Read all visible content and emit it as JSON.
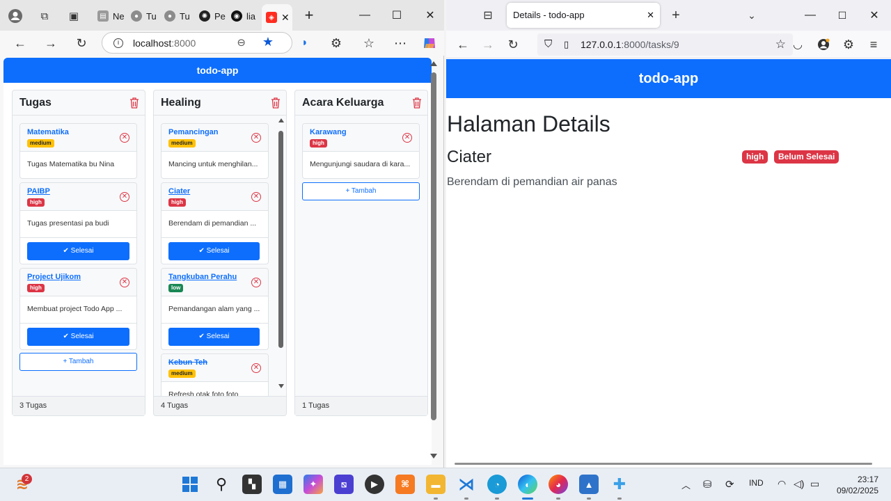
{
  "edge": {
    "tabs": [
      {
        "label": "Ne"
      },
      {
        "label": "Tu"
      },
      {
        "label": "Tu"
      },
      {
        "label": "Pe"
      },
      {
        "label": "lia"
      }
    ],
    "url": {
      "host": "localhost",
      "port": ":8000"
    },
    "app_title": "todo-app",
    "columns": [
      {
        "title": "Tugas",
        "footer": "3 Tugas",
        "add_label": "+ Tambah",
        "cards": [
          {
            "name": "Matematika",
            "priority": "medium",
            "desc": "Tugas Matematika bu Nina"
          },
          {
            "name": "PAIBP",
            "priority": "high",
            "desc": "Tugas presentasi pa budi",
            "done_label": "✔ Selesai"
          },
          {
            "name": "Project Ujikom",
            "priority": "high",
            "desc": "Membuat project Todo App ...",
            "done_label": "✔ Selesai"
          }
        ]
      },
      {
        "title": "Healing",
        "footer": "4 Tugas",
        "cards": [
          {
            "name": "Pemancingan",
            "priority": "medium",
            "desc": "Mancing untuk menghilan..."
          },
          {
            "name": "Ciater",
            "priority": "high",
            "desc": "Berendam di pemandian ...",
            "done_label": "✔ Selesai"
          },
          {
            "name": "Tangkuban Perahu",
            "priority": "low",
            "desc": "Pemandangan alam yang ...",
            "done_label": "✔ Selesai"
          },
          {
            "name": "Kebun Teh",
            "priority": "medium",
            "desc": "Refresh otak foto foto"
          }
        ]
      },
      {
        "title": "Acara Keluarga",
        "footer": "1 Tugas",
        "add_label": "+ Tambah",
        "cards": [
          {
            "name": "Karawang",
            "priority": "high",
            "desc": "Mengunjungi saudara di kara..."
          }
        ]
      }
    ]
  },
  "firefox": {
    "tab_title": "Details - todo-app",
    "url": {
      "host": "127.0.0.1",
      "path": ":8000/tasks/9"
    },
    "app_title": "todo-app",
    "heading": "Halaman Details",
    "task_name": "Ciater",
    "priority_badge": "high",
    "status_badge": "Belum Selesai",
    "description": "Berendam di pemandian air panas"
  },
  "taskbar": {
    "notification_count": "2",
    "language": "IND",
    "time": "23:17",
    "date": "09/02/2025"
  }
}
